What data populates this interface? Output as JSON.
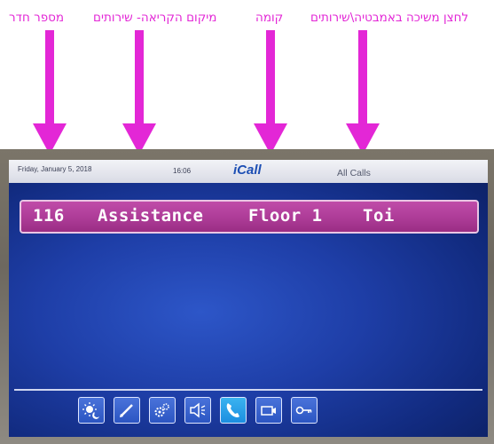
{
  "annotations": [
    {
      "text": "מספר חדר"
    },
    {
      "text": "מיקום הקריאה- שירותים"
    },
    {
      "text": "קומה"
    },
    {
      "text": "לחצן משיכה באמבטיה\\שירותים"
    }
  ],
  "colors": {
    "annotation": "#e327d6",
    "callbar": "#ab3a95",
    "screen": "#1e3ea7"
  },
  "status": {
    "date": "Friday, January 5, 2018",
    "time": "16:06",
    "logo": "iCall",
    "view": "All Calls"
  },
  "call": {
    "room": "116",
    "type": "Assistance",
    "floor": "Floor 1",
    "location": "Toi"
  },
  "toolbar": [
    {
      "icon": "day-night-icon"
    },
    {
      "icon": "edit-icon"
    },
    {
      "icon": "settings-icon"
    },
    {
      "icon": "speaker-icon"
    },
    {
      "icon": "phone-icon",
      "active": true
    },
    {
      "icon": "camera-icon"
    },
    {
      "icon": "key-icon"
    }
  ]
}
